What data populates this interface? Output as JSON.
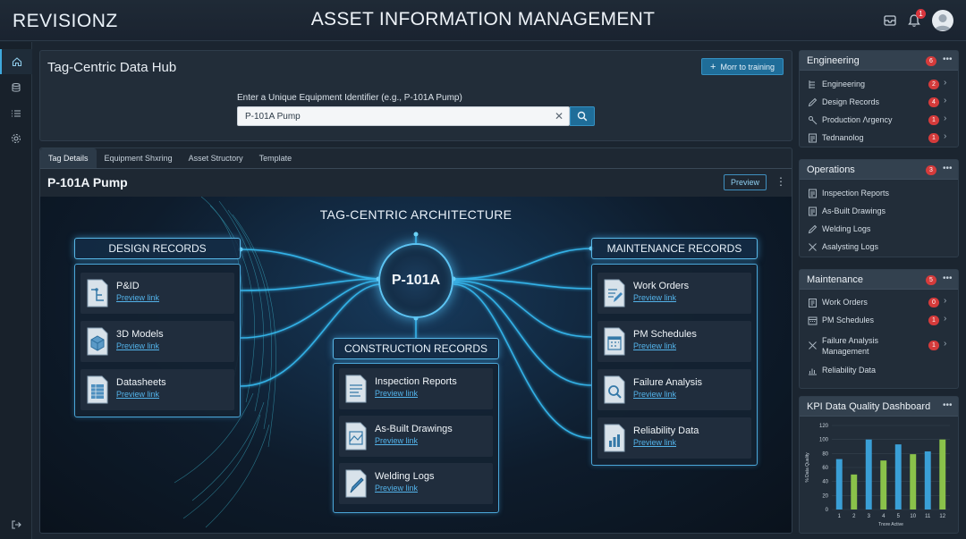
{
  "header": {
    "logo_text": "REVISIONZ",
    "app_title": "ASSET INFORMATION MANAGEMENT",
    "notification_count": "1",
    "icons": [
      "inbox-icon",
      "bell-icon",
      "user-avatar-icon"
    ]
  },
  "rail": {
    "icons": [
      "home-icon",
      "database-icon",
      "list-icon",
      "settings-icon",
      "logout-icon"
    ]
  },
  "hub": {
    "title": "Tag-Centric Data Hub",
    "training_button": "Morr to training",
    "search_label": "Enter a Unique Equipment Identifier (e.g., P-101A Pump)",
    "search_value": "P-101A Pump"
  },
  "tabs": [
    {
      "label": "Tag Details",
      "active": true
    },
    {
      "label": "Equipment Shxring",
      "active": false
    },
    {
      "label": "Asset Structory",
      "active": false
    },
    {
      "label": "Template",
      "active": false
    }
  ],
  "detail": {
    "title": "P-101A Pump",
    "preview_button": "Preview"
  },
  "diagram": {
    "title": "TAG-CENTRIC ARCHITECTURE",
    "center_label": "P-101A",
    "design": {
      "header": "DESIGN RECORDS",
      "items": [
        {
          "name": "P&ID",
          "link": "Preview link",
          "icon": "pid-document-icon"
        },
        {
          "name": "3D Models",
          "link": "Preview link",
          "icon": "cube-document-icon"
        },
        {
          "name": "Datasheets",
          "link": "Preview link",
          "icon": "datasheet-document-icon"
        }
      ]
    },
    "construction": {
      "header": "CONSTRUCTION RECORDS",
      "items": [
        {
          "name": "Inspection Reports",
          "link": "Preview link",
          "icon": "inspection-document-icon"
        },
        {
          "name": "As-Built Drawings",
          "link": "Preview link",
          "icon": "drawing-document-icon"
        },
        {
          "name": "Welding Logs",
          "link": "Preview link",
          "icon": "welding-document-icon"
        }
      ]
    },
    "maintenance": {
      "header": "MAINTENANCE RECORDS",
      "items": [
        {
          "name": "Work Orders",
          "link": "Preview link",
          "icon": "work-order-document-icon"
        },
        {
          "name": "PM Schedules",
          "link": "Preview link",
          "icon": "calendar-document-icon"
        },
        {
          "name": "Failure Analysis",
          "link": "Preview link",
          "icon": "magnifier-document-icon"
        },
        {
          "name": "Reliability Data",
          "link": "Preview link",
          "icon": "bar-chart-document-icon"
        }
      ]
    }
  },
  "sidebar": {
    "engineering": {
      "title": "Engineering",
      "badge": "6",
      "items": [
        {
          "label": "Engineering",
          "badge": "2",
          "icon": "tree-icon"
        },
        {
          "label": "Design Records",
          "badge": "4",
          "icon": "pencil-icon"
        },
        {
          "label": "Production Λrgency",
          "badge": "1",
          "icon": "wrench-icon"
        },
        {
          "label": "Tednanolog",
          "badge": "1",
          "icon": "document-icon"
        }
      ]
    },
    "operations": {
      "title": "Operations",
      "badge": "3",
      "items": [
        {
          "label": "Inspection Reports",
          "icon": "document-icon"
        },
        {
          "label": "As-Built Drawings",
          "icon": "document-icon"
        },
        {
          "label": "Welding Logs",
          "icon": "pencil-icon"
        },
        {
          "label": "Asalysting Logs",
          "icon": "tools-icon"
        }
      ]
    },
    "maintenance": {
      "title": "Maintenance",
      "badge": "5",
      "items": [
        {
          "label": "Work Orders",
          "badge": "0",
          "icon": "clipboard-icon"
        },
        {
          "label": "PM Schedules",
          "badge": "1",
          "icon": "calendar-icon"
        },
        {
          "label": "Failure Analysis Management",
          "badge": "1",
          "icon": "tools-icon"
        },
        {
          "label": "Reliability Data",
          "icon": "chart-icon"
        }
      ]
    },
    "kpi": {
      "title": "KPI Data Quality Dashboard"
    }
  },
  "chart_data": {
    "type": "bar",
    "title": "KPI Data Quality Dashboard",
    "ylabel": "% Data Quality",
    "xlabel": "Tnore Active",
    "ylim": [
      0,
      120
    ],
    "yticks": [
      0,
      20,
      40,
      60,
      80,
      100,
      120
    ],
    "categories": [
      "1",
      "2",
      "3",
      "4",
      "5",
      "10",
      "11",
      "12"
    ],
    "values": [
      72,
      50,
      100,
      70,
      93,
      79,
      83,
      100
    ],
    "colors": [
      "#3a9fd6",
      "#8ac24a",
      "#3a9fd6",
      "#8ac24a",
      "#3a9fd6",
      "#8ac24a",
      "#3a9fd6",
      "#8ac24a"
    ]
  },
  "colors": {
    "accent": "#3fa9dd",
    "badge_red": "#d53b3b",
    "background": "#1b2530"
  }
}
